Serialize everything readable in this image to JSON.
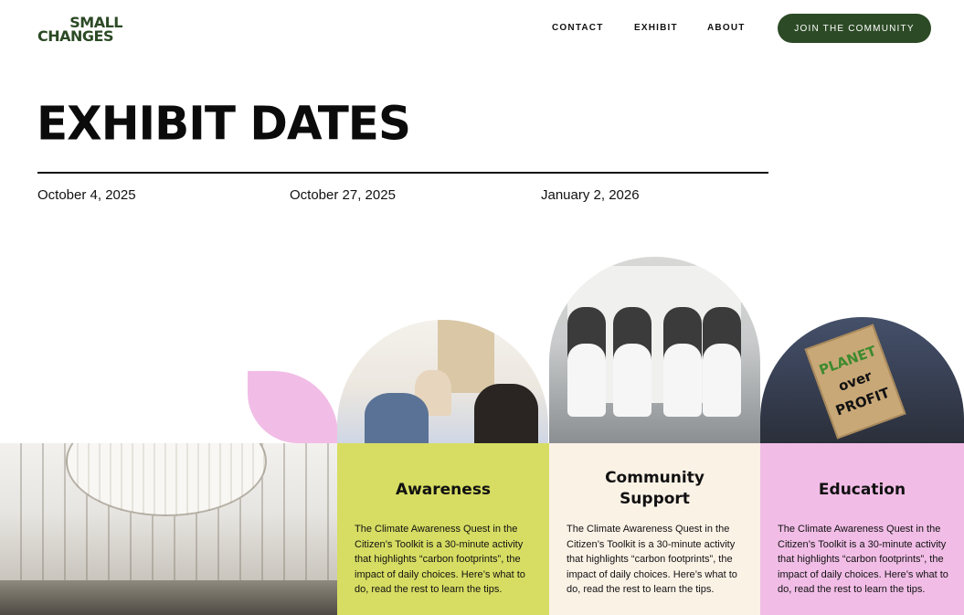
{
  "header": {
    "logo_line1": "SMALL",
    "logo_line2": "CHANGES",
    "nav": [
      "CONTACT",
      "EXHIBIT",
      "ABOUT"
    ],
    "cta_label": "JOIN THE COMMUNITY",
    "brand_color": "#2c4a25"
  },
  "hero": {
    "title": "EXHIBIT DATES",
    "dates": [
      "October 4, 2025",
      "October 27, 2025",
      "January 2, 2026"
    ]
  },
  "images": {
    "protest_sign": [
      "PLANET",
      "over",
      "PROFIT"
    ]
  },
  "cards": [
    {
      "title_lines": [
        "Awareness"
      ],
      "text": "The Climate Awareness Quest in the Citizen’s Toolkit is a 30-minute activity that highlights “carbon footprints”, the impact of daily choices. Here’s what to do, read the rest to learn the tips.",
      "color": "#d7dd62"
    },
    {
      "title_lines": [
        "Community",
        "Support"
      ],
      "text": "The Climate Awareness Quest in the Citizen’s Toolkit is a 30-minute activity that highlights “carbon footprints”, the impact of daily choices. Here’s what to do, read the rest to learn the tips.",
      "color": "#fbf2e6"
    },
    {
      "title_lines": [
        "Education"
      ],
      "text": "The Climate Awareness Quest in the Citizen’s Toolkit is a 30-minute activity that highlights “carbon footprints”, the impact of daily choices. Here’s what to do, read the rest to learn the tips.",
      "color": "#f1bde6"
    }
  ]
}
